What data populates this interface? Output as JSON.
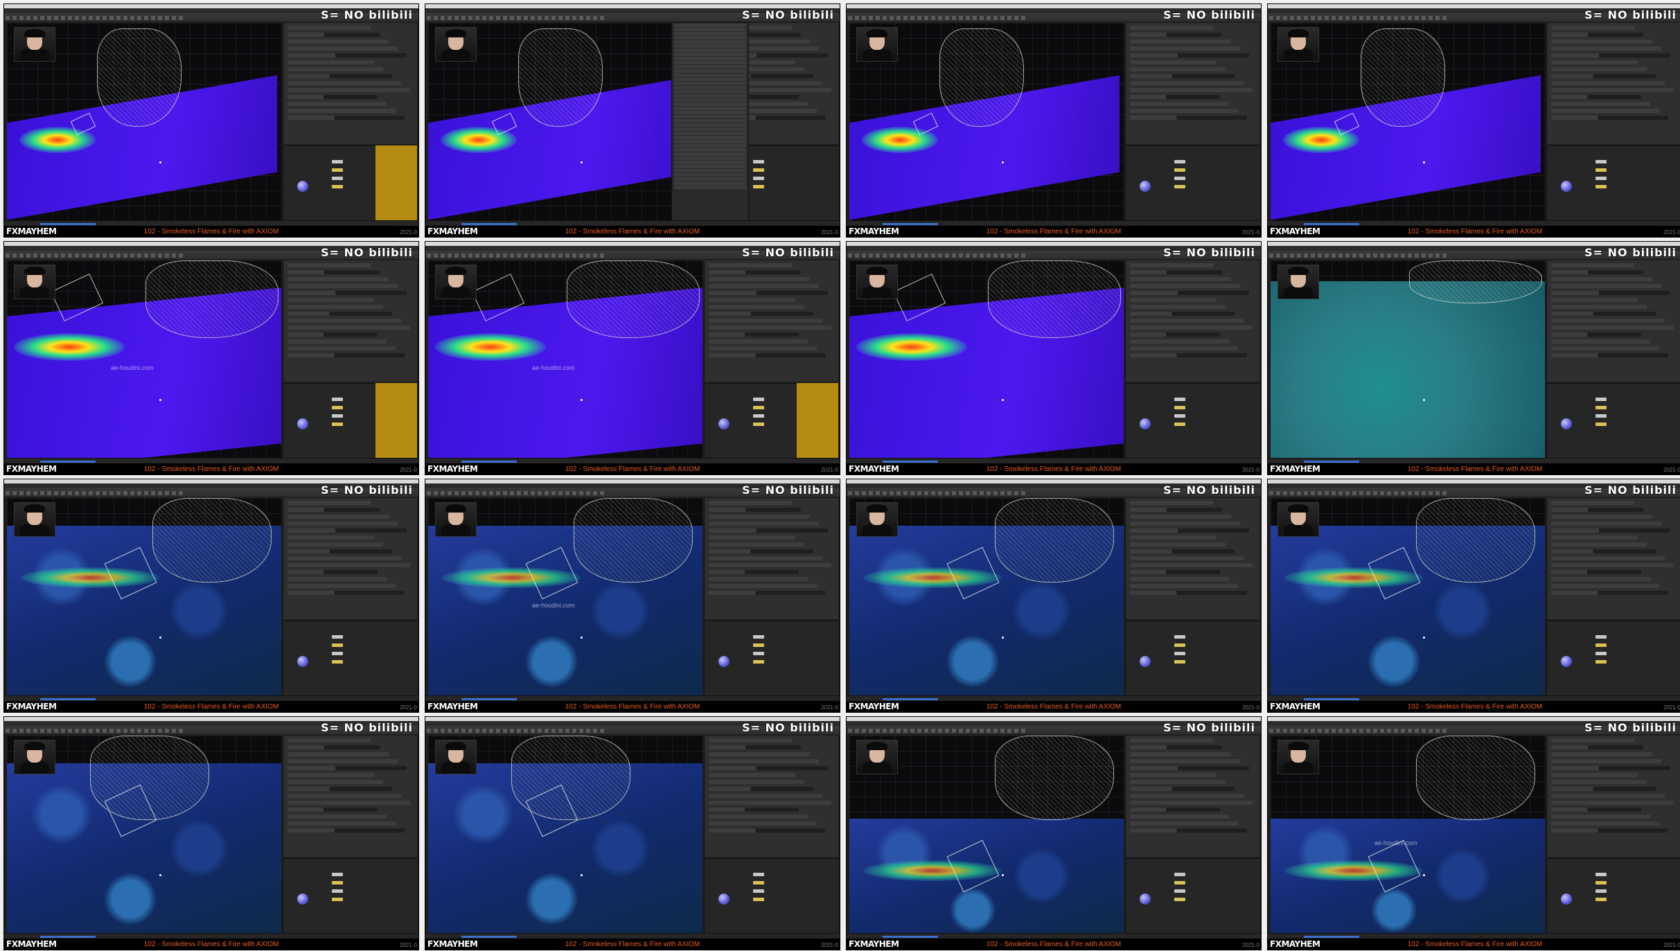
{
  "sheet": {
    "brand": "FXMAYHEM",
    "caption": "102 - Smokeless Flames & Fire with AXIOM",
    "stamp": "2021-0",
    "watermark": "S= NO bilibili",
    "site_tag": "ae-houdini.com"
  },
  "colors": {
    "caption": "#e85d22",
    "plane_purple": "#4c18ee",
    "plane_teal": "#2a7d86",
    "param_panel": "#2f2f2f",
    "highlight_panel": "#b48c12"
  },
  "tiles": [
    {
      "scene": "purple-plane",
      "has_menu": false,
      "has_side_panel": true,
      "site_tag": ""
    },
    {
      "scene": "purple-plane",
      "has_menu": true,
      "has_side_panel": false,
      "site_tag": ""
    },
    {
      "scene": "purple-plane",
      "has_menu": false,
      "has_side_panel": false,
      "site_tag": ""
    },
    {
      "scene": "purple-plane",
      "has_menu": false,
      "has_side_panel": false,
      "site_tag": ""
    },
    {
      "scene": "purple-smoke",
      "has_menu": false,
      "has_side_panel": true,
      "site_tag": "ae-houdini.com"
    },
    {
      "scene": "purple-smoke",
      "has_menu": false,
      "has_side_panel": true,
      "site_tag": "ae-houdini.com"
    },
    {
      "scene": "purple-smoke",
      "has_menu": false,
      "has_side_panel": false,
      "site_tag": ""
    },
    {
      "scene": "teal-plane",
      "has_menu": false,
      "has_side_panel": false,
      "site_tag": ""
    },
    {
      "scene": "noise-blend",
      "has_menu": false,
      "has_side_panel": false,
      "site_tag": ""
    },
    {
      "scene": "noise-blend",
      "has_menu": false,
      "has_side_panel": false,
      "site_tag": "ae-houdini.com"
    },
    {
      "scene": "noise-closeup",
      "has_menu": false,
      "has_side_panel": false,
      "site_tag": ""
    },
    {
      "scene": "noise-closeup",
      "has_menu": false,
      "has_side_panel": false,
      "site_tag": ""
    },
    {
      "scene": "noise-dark",
      "has_menu": false,
      "has_side_panel": false,
      "site_tag": ""
    },
    {
      "scene": "noise-dark",
      "has_menu": false,
      "has_side_panel": false,
      "site_tag": ""
    },
    {
      "scene": "noise-wide",
      "has_menu": false,
      "has_side_panel": false,
      "site_tag": ""
    },
    {
      "scene": "noise-wide",
      "has_menu": false,
      "has_side_panel": false,
      "site_tag": "ae-houdini.com"
    }
  ]
}
